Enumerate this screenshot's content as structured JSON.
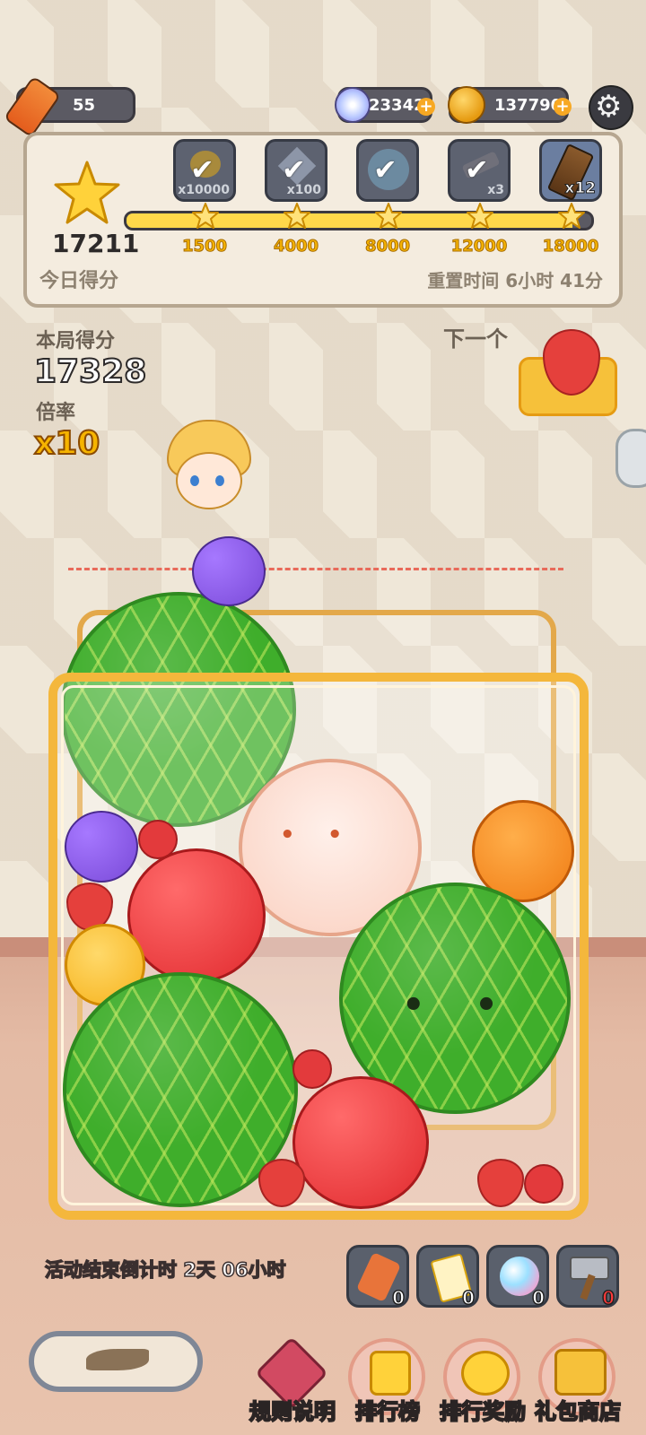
{
  "top_bar": {
    "energy_value": "55",
    "gems_value": "23342",
    "coins_value": "137790",
    "plus_symbol": "+"
  },
  "daily": {
    "total_score": "17211",
    "label": "今日得分",
    "reset_text": "重置时间 6小时 41分",
    "rewards": [
      {
        "multiplier": "x10000",
        "claimed": true,
        "icon": "coin-stack-icon"
      },
      {
        "multiplier": "x100",
        "claimed": true,
        "icon": "gem-icon"
      },
      {
        "multiplier": "",
        "claimed": true,
        "icon": "skin-icon"
      },
      {
        "multiplier": "x3",
        "claimed": true,
        "icon": "tool-icon"
      },
      {
        "multiplier": "x12",
        "claimed": false,
        "icon": "candy-bar-icon"
      }
    ],
    "milestones": [
      "1500",
      "4000",
      "8000",
      "12000",
      "18000"
    ],
    "progress": 0.96
  },
  "round": {
    "score_label": "本局得分",
    "score_value": "17328",
    "multiplier_label": "倍率",
    "multiplier_value": "x10",
    "next_label": "下一个",
    "next_fruit": "strawberry"
  },
  "countdown": "活动结束倒计时 2天 06小时",
  "tools": [
    {
      "icon": "candy-tools-icon",
      "count": "0"
    },
    {
      "icon": "star-card-icon",
      "count": "0"
    },
    {
      "icon": "orb-icon",
      "count": "0"
    },
    {
      "icon": "hammer-icon",
      "count": "0"
    }
  ],
  "nav": [
    {
      "label": "规则说明",
      "icon": "rules-icon"
    },
    {
      "label": "排行榜",
      "icon": "leaderboard-icon"
    },
    {
      "label": "排行奖励",
      "icon": "rank-reward-icon"
    },
    {
      "label": "礼包商店",
      "icon": "gift-shop-icon"
    }
  ],
  "colors": {
    "accent_gold": "#f6b400",
    "melon_green": "#3fae2b",
    "apple_red": "#e8353a",
    "frame_gold": "#f4b73c"
  }
}
